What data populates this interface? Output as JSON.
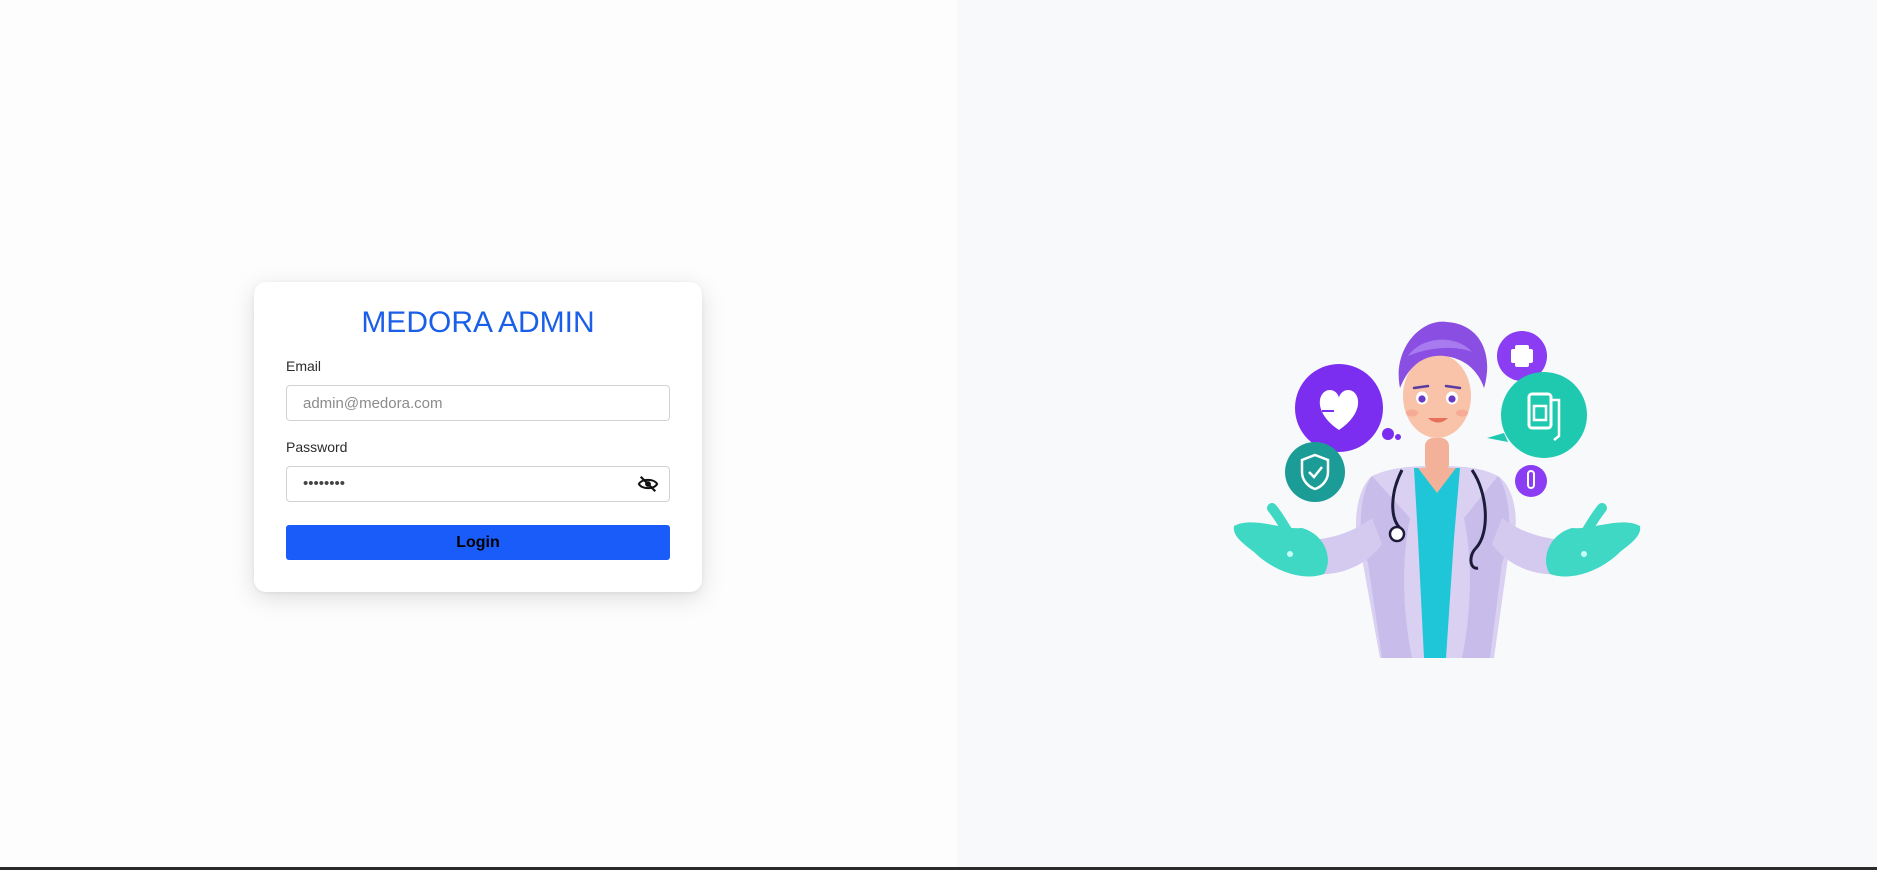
{
  "app": {
    "title": "MEDORA ADMIN"
  },
  "login_form": {
    "email_label": "Email",
    "email_placeholder": "admin@medora.com",
    "email_value": "",
    "password_label": "Password",
    "password_masked": "••••••••",
    "password_visibility_icon": "eye-slash-icon",
    "login_label": "Login"
  },
  "illustration": {
    "subject": "doctor-illustration",
    "icons": [
      "heart-icon",
      "plus-icon",
      "iv-bag-icon",
      "shield-check-icon",
      "test-tube-icon"
    ]
  },
  "colors": {
    "accent": "#1a5fe8",
    "button": "#1a5cfa",
    "right_background": "#f8f9fb"
  }
}
